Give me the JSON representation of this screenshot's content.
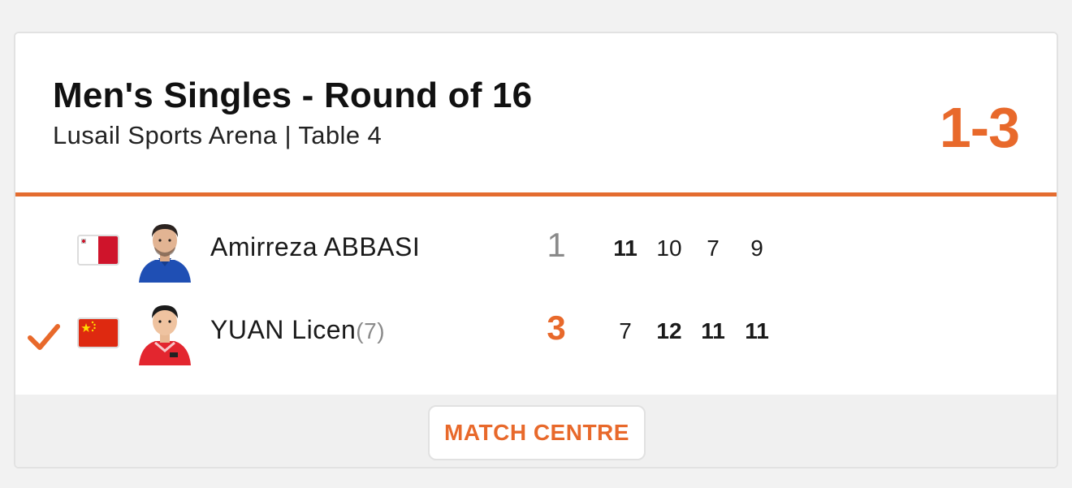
{
  "match": {
    "title": "Men's Singles - Round of 16",
    "venue": "Lusail Sports Arena | Table 4",
    "overall_score": "1-3",
    "accent_color": "#e8692b"
  },
  "players": [
    {
      "name": "Amirreza ABBASI",
      "seed": "",
      "flag": "malta-flag",
      "winner": false,
      "sets_won": "1",
      "games": [
        "11",
        "10",
        "7",
        "9"
      ]
    },
    {
      "name": "YUAN Licen",
      "seed": "(7)",
      "flag": "china-flag",
      "winner": true,
      "sets_won": "3",
      "games": [
        "7",
        "12",
        "11",
        "11"
      ]
    }
  ],
  "footer": {
    "match_centre_label": "MATCH CENTRE"
  }
}
